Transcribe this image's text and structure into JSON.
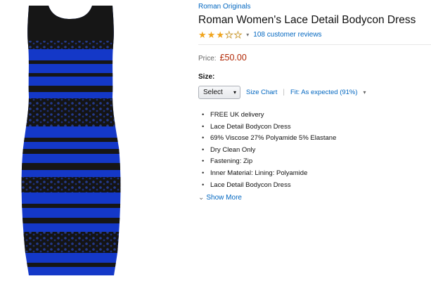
{
  "product": {
    "brand": "Roman Originals",
    "title": "Roman Women's Lace Detail Bodycon Dress",
    "rating": {
      "value": 3,
      "max": 5,
      "reviews_text": "108 customer reviews"
    },
    "price_label": "Price:",
    "price": "£50.00",
    "size_label": "Size:",
    "size_select": "Select",
    "size_chart": "Size Chart",
    "fit_separator": "|",
    "fit": "Fit: As expected (91%)",
    "features": [
      "FREE UK delivery",
      "Lace Detail Bodycon Dress",
      "69% Viscose 27% Polyamide 5% Elastane",
      "Dry Clean Only",
      "Fastening: Zip",
      "Inner Material: Lining: Polyamide",
      "Lace Detail Bodycon Dress"
    ],
    "show_more": "Show More"
  },
  "icons": {
    "star": "★",
    "caret": "▾",
    "chevron": "⌄"
  },
  "colors": {
    "link": "#0066c0",
    "price": "#b12704",
    "star": "#f0a41c",
    "dress_blue": "#1438c8",
    "dress_black": "#151515"
  }
}
